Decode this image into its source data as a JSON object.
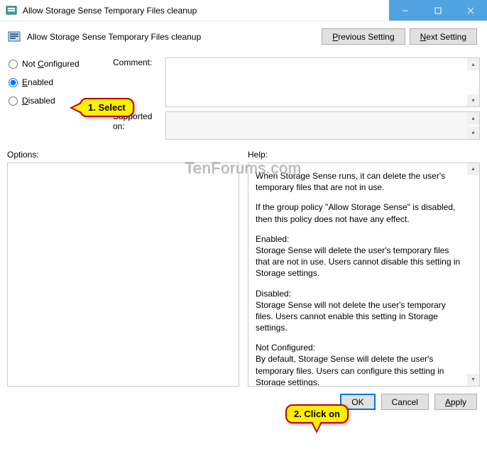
{
  "window": {
    "title": "Allow Storage Sense Temporary Files cleanup"
  },
  "header": {
    "policy_title": "Allow Storage Sense Temporary Files cleanup"
  },
  "nav": {
    "prev": "Previous Setting",
    "next": "Next Setting"
  },
  "radios": {
    "not_configured": "Not Configured",
    "enabled": "Enabled",
    "disabled": "Disabled",
    "selected": "enabled"
  },
  "labels": {
    "comment": "Comment:",
    "supported": "Supported on:",
    "options": "Options:",
    "help": "Help:"
  },
  "fields": {
    "comment": "",
    "supported": "",
    "options": ""
  },
  "help": {
    "p1": "When Storage Sense runs, it can delete the user's temporary files that are not in use.",
    "p2": "If the group policy \"Allow Storage Sense\" is disabled, then this policy does not have any effect.",
    "p3": "Enabled:",
    "p4": "Storage Sense will delete the user's temporary files that are not in use. Users cannot disable this setting in Storage settings.",
    "p5": "Disabled:",
    "p6": "Storage Sense will not delete the user's temporary files. Users cannot enable this setting in Storage settings.",
    "p7": "Not Configured:",
    "p8": "By default, Storage Sense will delete the user's temporary files. Users can configure this setting in Storage settings."
  },
  "buttons": {
    "ok": "OK",
    "cancel": "Cancel",
    "apply": "Apply"
  },
  "callouts": {
    "c1": "1. Select",
    "c2": "2. Click on"
  },
  "watermark": "TenForums.com"
}
